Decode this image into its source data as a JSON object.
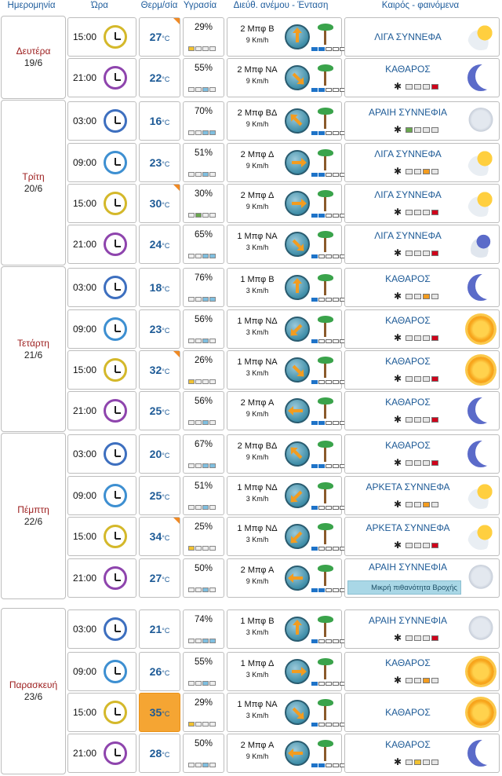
{
  "headers": {
    "date": "Ημερομηνία",
    "time": "Ώρα",
    "temp": "Θερμ/σία",
    "humidity": "Υγρασία",
    "wind": "Διεύθ. ανέμου - Ένταση",
    "weather": "Καιρός - φαινόμενα"
  },
  "temp_unit": "°C",
  "days": [
    {
      "name": "Δευτέρα",
      "date": "19/6"
    },
    {
      "name": "Τρίτη",
      "date": "20/6"
    },
    {
      "name": "Τετάρτη",
      "date": "21/6"
    },
    {
      "name": "Πέμπτη",
      "date": "22/6"
    },
    {
      "name": "Παρασκευή",
      "date": "23/6"
    }
  ],
  "rows": [
    {
      "time": "15:00",
      "temp": "27",
      "hum": "29%",
      "wind": "2 Μπφ Β",
      "speed": "9 Km/h",
      "wx": "ΛΙΓΑ ΣΥΝΝΕΦΑ",
      "icon": "cloud-sun"
    },
    {
      "time": "21:00",
      "temp": "22",
      "hum": "55%",
      "wind": "2 Μπφ ΝΑ",
      "speed": "9 Km/h",
      "wx": "ΚΑΘΑΡΟΣ",
      "icon": "moon"
    },
    {
      "time": "03:00",
      "temp": "16",
      "hum": "70%",
      "wind": "2 Μπφ ΒΔ",
      "speed": "9 Km/h",
      "wx": "ΑΡΑΙΗ ΣΥΝΝΕΦΙΑ",
      "icon": "cloud-pale"
    },
    {
      "time": "09:00",
      "temp": "23",
      "hum": "51%",
      "wind": "2 Μπφ Δ",
      "speed": "9 Km/h",
      "wx": "ΛΙΓΑ ΣΥΝΝΕΦΑ",
      "icon": "cloud-sun"
    },
    {
      "time": "15:00",
      "temp": "30",
      "hum": "30%",
      "wind": "2 Μπφ Δ",
      "speed": "9 Km/h",
      "wx": "ΛΙΓΑ ΣΥΝΝΕΦΑ",
      "icon": "cloud-sun"
    },
    {
      "time": "21:00",
      "temp": "24",
      "hum": "65%",
      "wind": "1 Μπφ ΝΑ",
      "speed": "3 Km/h",
      "wx": "ΛΙΓΑ ΣΥΝΝΕΦΑ",
      "icon": "cloud-moon"
    },
    {
      "time": "03:00",
      "temp": "18",
      "hum": "76%",
      "wind": "1 Μπφ Β",
      "speed": "3 Km/h",
      "wx": "ΚΑΘΑΡΟΣ",
      "icon": "moon"
    },
    {
      "time": "09:00",
      "temp": "23",
      "hum": "56%",
      "wind": "1 Μπφ ΝΔ",
      "speed": "3 Km/h",
      "wx": "ΚΑΘΑΡΟΣ",
      "icon": "sun"
    },
    {
      "time": "15:00",
      "temp": "32",
      "hum": "26%",
      "wind": "1 Μπφ ΝΑ",
      "speed": "3 Km/h",
      "wx": "ΚΑΘΑΡΟΣ",
      "icon": "sun"
    },
    {
      "time": "21:00",
      "temp": "25",
      "hum": "56%",
      "wind": "2 Μπφ Α",
      "speed": "9 Km/h",
      "wx": "ΚΑΘΑΡΟΣ",
      "icon": "moon"
    },
    {
      "time": "03:00",
      "temp": "20",
      "hum": "67%",
      "wind": "2 Μπφ ΒΔ",
      "speed": "9 Km/h",
      "wx": "ΚΑΘΑΡΟΣ",
      "icon": "moon"
    },
    {
      "time": "09:00",
      "temp": "25",
      "hum": "51%",
      "wind": "1 Μπφ ΝΔ",
      "speed": "3 Km/h",
      "wx": "ΑΡΚΕΤΑ ΣΥΝΝΕΦΑ",
      "icon": "cloud-sun"
    },
    {
      "time": "15:00",
      "temp": "34",
      "hum": "25%",
      "wind": "1 Μπφ ΝΔ",
      "speed": "3 Km/h",
      "wx": "ΑΡΚΕΤΑ ΣΥΝΝΕΦΑ",
      "icon": "cloud-sun"
    },
    {
      "time": "21:00",
      "temp": "27",
      "hum": "50%",
      "wind": "2 Μπφ Α",
      "speed": "9 Km/h",
      "wx": "ΑΡΑΙΗ ΣΥΝΝΕΦΙΑ",
      "icon": "cloud-pale",
      "rain": "Μικρή πιθανότητα Βροχής"
    },
    {
      "time": "03:00",
      "temp": "21",
      "hum": "74%",
      "wind": "1 Μπφ Β",
      "speed": "3 Km/h",
      "wx": "ΑΡΑΙΗ ΣΥΝΝΕΦΙΑ",
      "icon": "cloud-pale"
    },
    {
      "time": "09:00",
      "temp": "26",
      "hum": "55%",
      "wind": "1 Μπφ Δ",
      "speed": "3 Km/h",
      "wx": "ΚΑΘΑΡΟΣ",
      "icon": "sun"
    },
    {
      "time": "15:00",
      "temp": "35",
      "hum": "29%",
      "wind": "1 Μπφ ΝΑ",
      "speed": "3 Km/h",
      "wx": "ΚΑΘΑΡΟΣ",
      "icon": "sun"
    },
    {
      "time": "21:00",
      "temp": "28",
      "hum": "50%",
      "wind": "2 Μπφ Α",
      "speed": "9 Km/h",
      "wx": "ΚΑΘΑΡΟΣ",
      "icon": "moon"
    }
  ]
}
